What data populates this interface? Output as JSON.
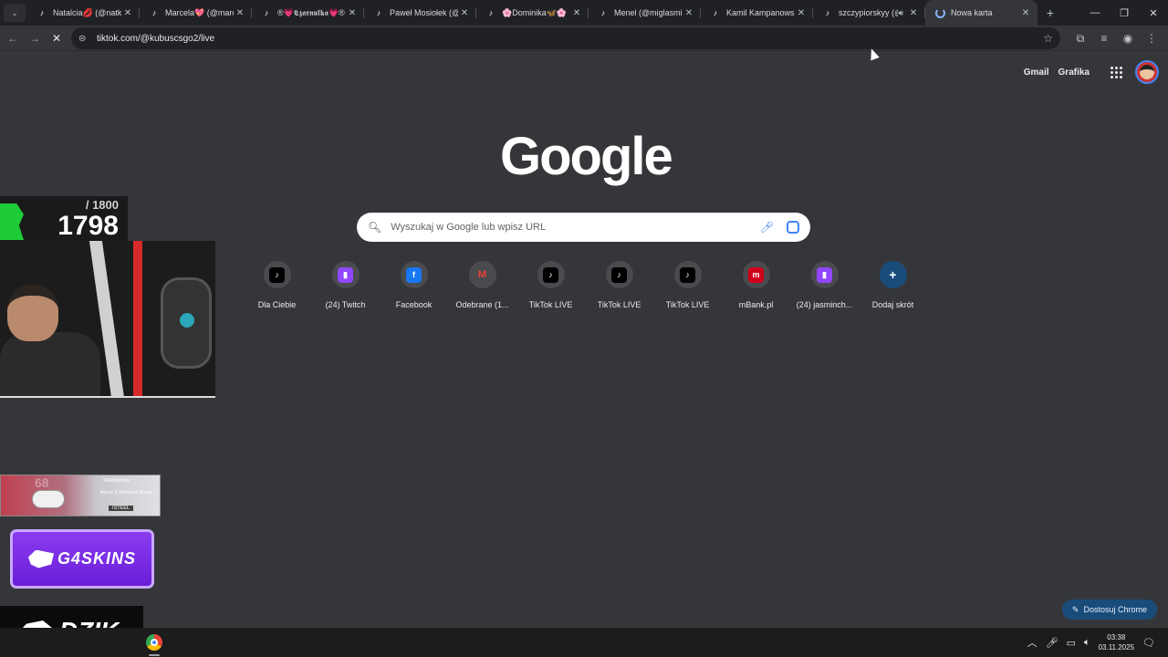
{
  "tabs": [
    {
      "title": "Natalcia💋 (@natka",
      "icon": "tiktok-icon",
      "active": false
    },
    {
      "title": "Marcela💖 (@marcel",
      "icon": "tiktok-icon",
      "active": false
    },
    {
      "title": "®💗𝕮𝖟𝖆𝖗𝖓𝖚𝖑𝖐𝖆💗® (",
      "icon": "tiktok-icon",
      "active": false
    },
    {
      "title": "Paweł Mosiołek (@pa",
      "icon": "tiktok-icon",
      "active": false
    },
    {
      "title": "🌸Dominika🦋🌸",
      "icon": "tiktok-icon",
      "active": false
    },
    {
      "title": "Menel (@miglasmig",
      "icon": "tiktok-icon",
      "active": false
    },
    {
      "title": "Kamil Kampanowski (",
      "icon": "tiktok-icon",
      "active": false
    },
    {
      "title": "szczypiorskyy (@",
      "icon": "tiktok-icon",
      "active": false,
      "audio": true
    },
    {
      "title": "Nowa karta",
      "icon": "loading-spinner-icon",
      "active": true
    }
  ],
  "address_bar": {
    "url": "tiktok.com/@kubuscsgo2/live"
  },
  "top_links": {
    "gmail": "Gmail",
    "images": "Grafika"
  },
  "search": {
    "placeholder": "Wyszukaj w Google lub wpisz URL"
  },
  "logo": "Google",
  "shortcuts": [
    {
      "label": "Dla Ciebie",
      "icon": "tiktok-icon",
      "glyph": "♪",
      "bg": "#000000"
    },
    {
      "label": "(24) Twitch",
      "icon": "twitch-icon",
      "glyph": "▮",
      "bg": "#9146ff"
    },
    {
      "label": "Facebook",
      "icon": "facebook-icon",
      "glyph": "f",
      "bg": "#1877f2"
    },
    {
      "label": "Odebrane (1...",
      "icon": "gmail-icon",
      "glyph": "M",
      "bg": "#4a4b4f"
    },
    {
      "label": "TikTok LIVE",
      "icon": "tiktok-icon",
      "glyph": "♪",
      "bg": "#000000"
    },
    {
      "label": "TikTok LIVE",
      "icon": "tiktok-icon",
      "glyph": "♪",
      "bg": "#000000"
    },
    {
      "label": "TikTok LIVE",
      "icon": "tiktok-icon",
      "glyph": "♪",
      "bg": "#000000"
    },
    {
      "label": "mBank.pl",
      "icon": "mbank-icon",
      "glyph": "m",
      "bg": "#d0021b"
    },
    {
      "label": "(24) jasminch...",
      "icon": "twitch-icon",
      "glyph": "▮",
      "bg": "#9146ff"
    },
    {
      "label": "Dodaj skrót",
      "icon": "plus-icon",
      "glyph": "+",
      "bg": "#1a4c7a"
    }
  ],
  "customize": {
    "label": "Dostosuj Chrome"
  },
  "overlay": {
    "counter_total": "/ 1800",
    "counter_value": "1798",
    "steel_brand": "steelseries",
    "steel_model": "Aerox 3 Wireless Snow",
    "steel_code": "ISTEEL",
    "steel_num": "68",
    "g4skins": "G4SKINS",
    "dzik": "DZIK."
  },
  "taskbar": {
    "time": "03:38",
    "date": "03.11.2025"
  },
  "colors": {
    "accent": "#8ab4f8",
    "page_bg": "#35363a",
    "tab_bg": "#202124"
  }
}
